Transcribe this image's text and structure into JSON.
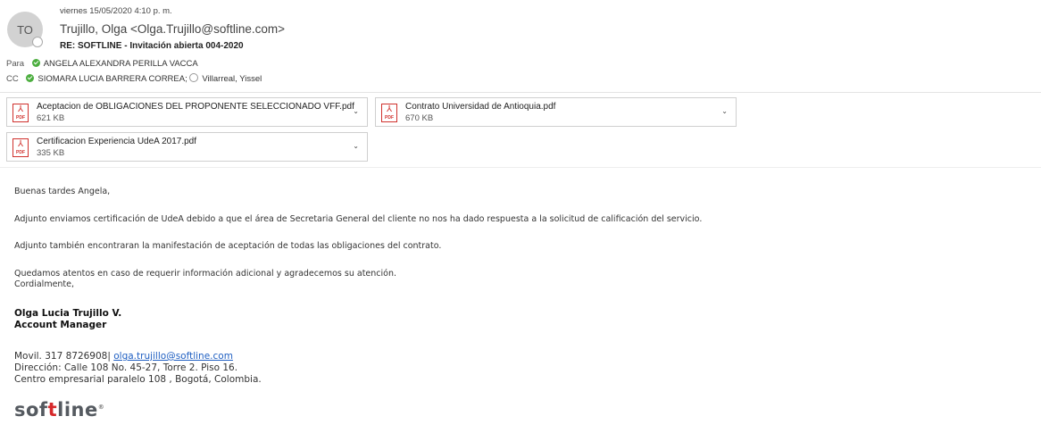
{
  "header": {
    "avatar_initials": "TO",
    "date": "viernes 15/05/2020 4:10 p. m.",
    "from": "Trujillo, Olga <Olga.Trujillo@softline.com>",
    "subject": "RE: SOFTLINE - Invitación abierta 004-2020",
    "to_label": "Para",
    "to": "ANGELA ALEXANDRA PERILLA VACCA",
    "cc_label": "CC",
    "cc_1": "SIOMARA LUCIA BARRERA CORREA;",
    "cc_2": "Villarreal, Yissel"
  },
  "attachments": [
    {
      "name": "Aceptacion de OBLIGACIONES DEL PROPONENTE SELECCIONADO VFF.pdf",
      "size": "621 KB",
      "icon": "pdf-icon"
    },
    {
      "name": "Contrato Universidad de Antioquia.pdf",
      "size": "670 KB",
      "icon": "pdf-icon"
    },
    {
      "name": "Certificacion Experiencia UdeA 2017.pdf",
      "size": "335 KB",
      "icon": "pdf-icon"
    }
  ],
  "body": {
    "greeting": "Buenas tardes Angela,",
    "p1": "Adjunto enviamos certificación de UdeA debido a que el área de Secretaria General del cliente no nos ha dado respuesta a la solicitud de calificación del servicio.",
    "p2": "Adjunto también encontraran la manifestación de aceptación de todas las obligaciones del contrato.",
    "p3": "Quedamos atentos en caso de requerir información adicional y agradecemos su atención.",
    "closing": "Cordialmente,"
  },
  "signature": {
    "name": "Olga Lucia Trujillo V.",
    "role": "Account Manager",
    "phone": "Movil. 317 8726908|",
    "email": "olga.trujillo@softline.com",
    "address": "Dirección: Calle 108 No. 45-27, Torre 2. Piso 16.",
    "center": "Centro empresarial paralelo 108 , Bogotá, Colombia.",
    "logo_text_a": "sof",
    "logo_text_b": "t",
    "logo_text_c": "line",
    "logo_mark": "®"
  },
  "colors": {
    "accent_link": "#1f5fc2",
    "logo_red": "#d6292b",
    "status_green": "#4cae3f"
  }
}
